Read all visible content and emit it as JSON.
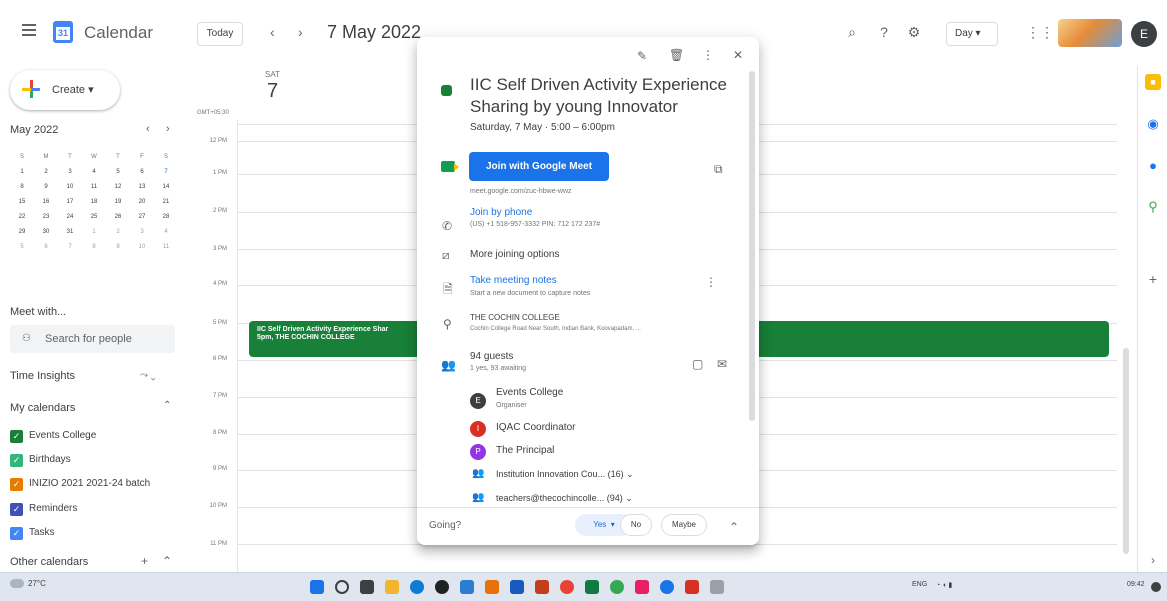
{
  "header": {
    "logo_day": "31",
    "app_title": "Calendar",
    "today_label": "Today",
    "prev_icon": "chevron-left-icon",
    "next_icon": "chevron-right-icon",
    "date_title": "7 May 2022",
    "view_select": "Day ▾",
    "avatar_letter": "E"
  },
  "sidebar": {
    "create_label": "Create ▾",
    "mini_month": "May 2022",
    "weekday_headers": [
      "S",
      "M",
      "T",
      "W",
      "T",
      "F",
      "S"
    ],
    "weeks": [
      [
        "1",
        "2",
        "3",
        "4",
        "5",
        "6",
        "7"
      ],
      [
        "8",
        "9",
        "10",
        "11",
        "12",
        "13",
        "14"
      ],
      [
        "15",
        "16",
        "17",
        "18",
        "19",
        "20",
        "21"
      ],
      [
        "22",
        "23",
        "24",
        "25",
        "26",
        "27",
        "28"
      ],
      [
        "29",
        "30",
        "31",
        "1",
        "2",
        "3",
        "4"
      ],
      [
        "5",
        "6",
        "7",
        "8",
        "9",
        "10",
        "11"
      ]
    ],
    "meet_with": "Meet with...",
    "search_people_placeholder": "Search for people",
    "time_insights": "Time Insights",
    "my_calendars": "My calendars",
    "calendars": [
      {
        "label": "Events College",
        "color": "#188038"
      },
      {
        "label": "Birthdays",
        "color": "#33b679"
      },
      {
        "label": "INIZIO 2021 2021-24 batch",
        "color": "#e67c73"
      },
      {
        "label": "Reminders",
        "color": "#3f51b5"
      },
      {
        "label": "Tasks",
        "color": "#4285f4"
      }
    ],
    "other_calendars": "Other calendars"
  },
  "grid": {
    "day_name": "SAT",
    "day_number": "7",
    "timezone": "GMT+05:30",
    "times": [
      "12 PM",
      "1 PM",
      "2 PM",
      "3 PM",
      "4 PM",
      "5 PM",
      "6 PM",
      "7 PM",
      "8 PM",
      "9 PM",
      "10 PM",
      "11 PM"
    ],
    "event_title": "IIC Self Driven Activity Experience Shar",
    "event_sub": "5pm, THE COCHIN COLLEGE"
  },
  "popup": {
    "title": "IIC Self Driven Activity Experience Sharing by young Innovator",
    "datetime": "Saturday, 7 May  ·  5:00 – 6:00pm",
    "meet_button": "Join with Google Meet",
    "meet_link": "meet.google.com/zuc-hbwe-wwz",
    "join_phone": "Join by phone",
    "phone_detail": "(US) +1 518-957-3332 PIN: 712 172 237#",
    "more_options": "More joining options",
    "notes_title": "Take meeting notes",
    "notes_sub": "Start a new document to capture notes",
    "location_title": "THE COCHIN COLLEGE",
    "location_sub": "Cochin College Road Near South, Indian Bank, Koovapadam, ...",
    "guests_count": "94 guests",
    "guests_sub": "1 yes, 93 awaiting",
    "guests": [
      {
        "initial": "E",
        "name": "Events College",
        "role": "Organiser",
        "color": "#3c4043"
      },
      {
        "initial": "I",
        "name": "IQAC Coordinator",
        "role": "",
        "color": "#d93025"
      },
      {
        "initial": "P",
        "name": "The Principal",
        "role": "",
        "color": "#9334e6"
      }
    ],
    "groups": [
      "Institution Innovation Cou... (16)  ⌄",
      "teachers@thecochincolle... (94)  ⌄"
    ],
    "going_label": "Going?",
    "rsvp_yes": "Yes",
    "rsvp_no": "No",
    "rsvp_maybe": "Maybe"
  },
  "taskbar": {
    "temperature": "27°C",
    "lang": "ENG",
    "time": "09:42"
  }
}
